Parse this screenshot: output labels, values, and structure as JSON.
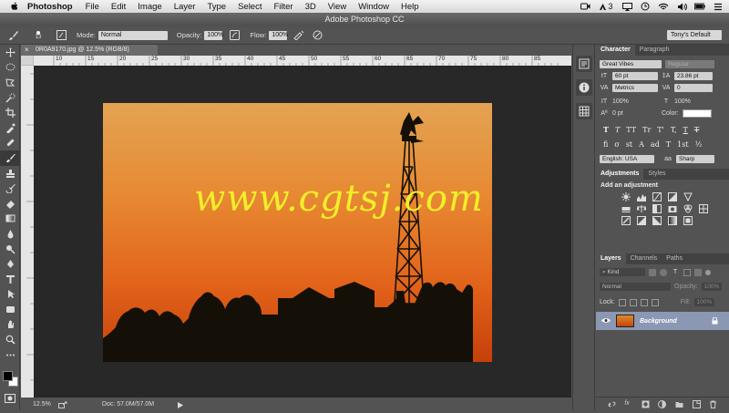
{
  "menubar": {
    "app_name": "Photoshop",
    "items": [
      "File",
      "Edit",
      "Image",
      "Layer",
      "Type",
      "Select",
      "Filter",
      "3D",
      "View",
      "Window",
      "Help"
    ],
    "tray_badge": "3"
  },
  "window": {
    "title": "Adobe Photoshop CC"
  },
  "options_bar": {
    "brush_size": "13",
    "mode_label": "Mode:",
    "mode_value": "Normal",
    "opacity_label": "Opacity:",
    "opacity_value": "100%",
    "flow_label": "Flow:",
    "flow_value": "100%",
    "workspace": "Tony's Default"
  },
  "document": {
    "tab_title": "0R0A9170.jpg @ 12.5% (RGB/8)",
    "ruler_ticks": [
      "10",
      "15",
      "20",
      "25",
      "30",
      "35",
      "40",
      "45",
      "50",
      "55",
      "60",
      "65",
      "70",
      "75",
      "80",
      "85"
    ],
    "watermark": "www.cgtsj.com"
  },
  "status": {
    "zoom": "12.5%",
    "doc_info": "Doc: 57.0M/57.0M"
  },
  "character_panel": {
    "tabs": [
      "Character",
      "Paragraph"
    ],
    "font_family": "Great Vibes",
    "font_style": "Regular",
    "font_size": "60 pt",
    "leading": "23.86 pt",
    "kerning": "Metrics",
    "tracking": "0",
    "vertical_scale": "100%",
    "horizontal_scale": "100%",
    "baseline_shift": "0 pt",
    "color_label": "Color:",
    "type_buttons": [
      "T",
      "T",
      "TT",
      "Tr",
      "T'",
      "T,",
      "T",
      "T"
    ],
    "feature_buttons": [
      "fi",
      "σ",
      "st",
      "A",
      "ad",
      "T",
      "1st",
      "½"
    ],
    "language": "English: USA",
    "aa_glyph": "aa",
    "antialias": "Sharp"
  },
  "adjustments_panel": {
    "tabs": [
      "Adjustments",
      "Styles"
    ],
    "heading": "Add an adjustment"
  },
  "layers_panel": {
    "tabs": [
      "Layers",
      "Channels",
      "Paths"
    ],
    "filter_label": "Kind",
    "blend_mode": "Normal",
    "opacity_label": "Opacity:",
    "opacity_value": "100%",
    "lock_label": "Lock:",
    "fill_label": "Fill:",
    "fill_value": "100%",
    "layers": [
      {
        "name": "Background",
        "visible": true,
        "locked": true
      }
    ]
  },
  "colors": {
    "accent_selected_layer": "#8b98b3",
    "sky_top": "#e3a352",
    "sky_bottom": "#e0520d",
    "watermark": "#f2ee2a"
  }
}
